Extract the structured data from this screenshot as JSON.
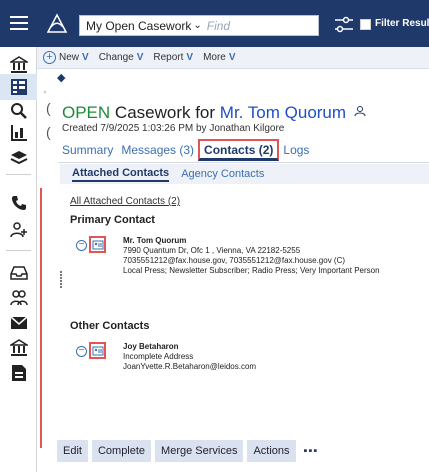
{
  "header": {
    "breadcrumb_label": "My Open Casework",
    "breadcrumb_chevron": "⌄",
    "find_placeholder": "Find",
    "filter_label": "Filter Result"
  },
  "toolbar": {
    "new": "New",
    "change": "Change",
    "report": "Report",
    "more": "More",
    "chevron": "V"
  },
  "page": {
    "title_status": "OPEN",
    "title_middle": " Casework for ",
    "title_person": "Mr. Tom Quorum",
    "created": "Created 7/9/2025 1:03:26 PM by Jonathan Kilgore",
    "left_cut_1": "(",
    "left_cut_2": "(",
    "left_cut_3": "'"
  },
  "tabs": [
    {
      "label": "Summary"
    },
    {
      "label": "Messages (3)"
    },
    {
      "label": "Contacts (2)"
    },
    {
      "label": "Logs"
    }
  ],
  "subtabs": [
    {
      "label": "Attached Contacts"
    },
    {
      "label": "Agency Contacts"
    }
  ],
  "contacts": {
    "all_link": "All Attached Contacts (2)",
    "primary_heading": "Primary Contact",
    "other_heading": "Other Contacts",
    "primary": {
      "name": "Mr. Tom Quorum",
      "address": "7990 Quantum Dr, Ofc 1 , Vienna, VA 22182-5255",
      "fax": "7035551212@fax.house.gov, 7035551212@fax.house.gov (C)",
      "tags": "Local Press; Newsletter Subscriber; Radio Press; Very Important Person"
    },
    "other": {
      "name": "Joy Betaharon",
      "address": "Incomplete Address",
      "email": "JoanYvette.R.Betaharon@leidos.com"
    }
  },
  "actions": {
    "edit": "Edit",
    "complete": "Complete",
    "merge": "Merge Services",
    "actions": "Actions",
    "more": "▪▪▪"
  },
  "colors": {
    "nav_bg": "#1f3a6a",
    "open_green": "#1e8a3a",
    "link_blue": "#1f4fc8",
    "highlight_red": "#e05555"
  },
  "rail_icons": [
    "menu-icon",
    "building-icon",
    "grid-icon",
    "search-icon",
    "chart-icon",
    "layers-icon",
    "phone-icon",
    "add-person-icon",
    "inbox-icon",
    "people-icon",
    "mail-icon",
    "bank-icon",
    "document-icon"
  ]
}
